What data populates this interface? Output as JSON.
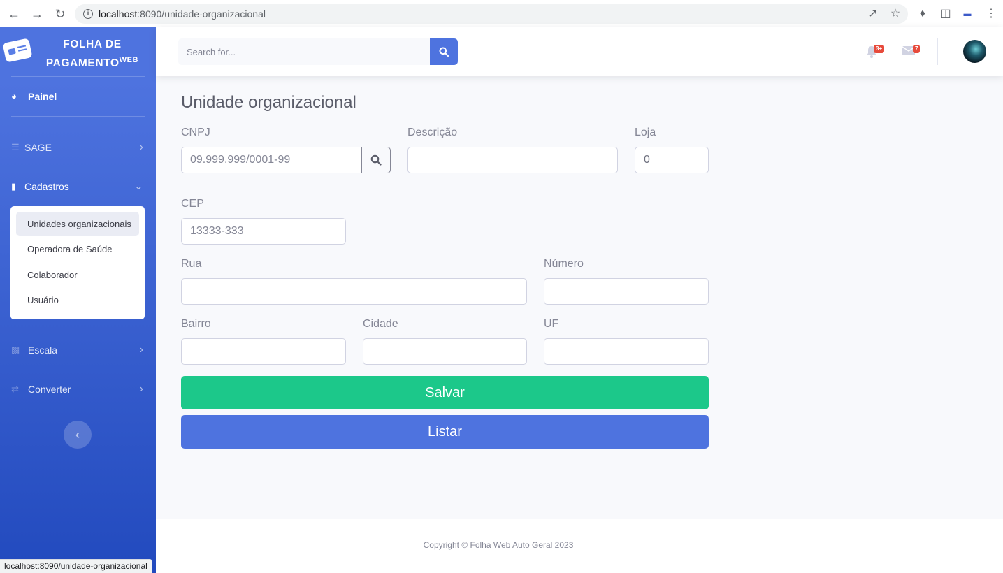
{
  "browser": {
    "url_host": "localhost",
    "url_path": ":8090/unidade-organizacional",
    "status_url": "localhost:8090/unidade-organizacional"
  },
  "brand": {
    "line1": "FOLHA DE",
    "line2": "PAGAMENTO",
    "sup": "WEB"
  },
  "sidebar": {
    "painel": "Painel",
    "items": [
      {
        "label": "SAGE",
        "icon": "database-icon"
      },
      {
        "label": "Cadastros",
        "icon": "file-icon"
      },
      {
        "label": "Escala",
        "icon": "briefcase-icon"
      },
      {
        "label": "Converter",
        "icon": "retweet-icon"
      }
    ],
    "submenu": [
      "Unidades organizacionais",
      "Operadora de Saúde",
      "Colaborador",
      "Usuário"
    ]
  },
  "topbar": {
    "search_placeholder": "Search for...",
    "alerts_badge": "3+",
    "messages_badge": "7"
  },
  "form": {
    "title": "Unidade organizacional",
    "cnpj_label": "CNPJ",
    "cnpj_placeholder": "09.999.999/0001-99",
    "descricao_label": "Descrição",
    "loja_label": "Loja",
    "loja_value": "0",
    "cep_label": "CEP",
    "cep_placeholder": "13333-333",
    "rua_label": "Rua",
    "numero_label": "Número",
    "bairro_label": "Bairro",
    "cidade_label": "Cidade",
    "uf_label": "UF",
    "save_label": "Salvar",
    "list_label": "Listar"
  },
  "footer": {
    "copyright": "Copyright © Folha Web Auto Geral 2023"
  },
  "colors": {
    "primary": "#4e73df",
    "success": "#1cc88a",
    "danger": "#e74a3b"
  }
}
